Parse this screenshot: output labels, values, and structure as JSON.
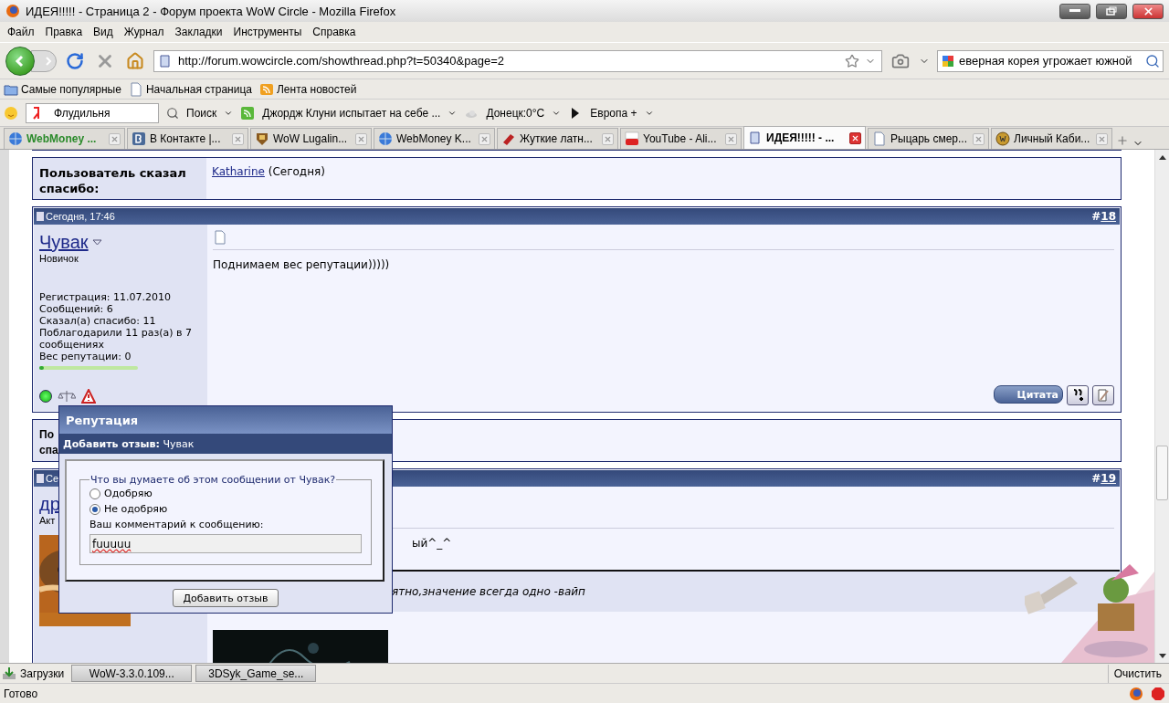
{
  "window": {
    "title": "ИДЕЯ!!!!! - Страница 2 - Форум проекта WoW Circle - Mozilla Firefox"
  },
  "menu": [
    "Файл",
    "Правка",
    "Вид",
    "Журнал",
    "Закладки",
    "Инструменты",
    "Справка"
  ],
  "address": {
    "value": "http://forum.wowcircle.com/showthread.php?t=50340&page=2"
  },
  "search": {
    "value": "еверная корея угрожает южной"
  },
  "bookmarks": [
    {
      "label": "Самые популярные",
      "kind": "folder"
    },
    {
      "label": "Начальная страница",
      "kind": "page"
    },
    {
      "label": "Лента новостей",
      "kind": "feed"
    }
  ],
  "yandex_bar": {
    "field": "Флудильня",
    "search": "Поиск",
    "news": "Джордж Клуни испытает на себе ...",
    "weather": "Донецк:0°С",
    "region": "Европа +"
  },
  "tabs": [
    {
      "label": "WebMoney ...",
      "kind": "globe",
      "highlighted": true,
      "selected": false
    },
    {
      "label": "В Контакте |...",
      "kind": "vk",
      "highlighted": false,
      "selected": false
    },
    {
      "label": "WoW Lugalin...",
      "kind": "shield",
      "highlighted": false,
      "selected": false
    },
    {
      "label": "WebMoney K...",
      "kind": "globe",
      "highlighted": false,
      "selected": false
    },
    {
      "label": "Жуткие латн...",
      "kind": "red",
      "highlighted": false,
      "selected": false
    },
    {
      "label": "YouTube - Ali...",
      "kind": "youtube",
      "highlighted": false,
      "selected": false
    },
    {
      "label": "ИДЕЯ!!!!! - ...",
      "kind": "forum",
      "highlighted": false,
      "selected": true
    },
    {
      "label": "Рыцарь смер...",
      "kind": "page",
      "highlighted": false,
      "selected": false
    },
    {
      "label": "Личный Каби...",
      "kind": "coin",
      "highlighted": false,
      "selected": false
    }
  ],
  "thanks": {
    "label": "Пользователь сказал спасибо:",
    "user": "Katharine",
    "when": "(Сегодня)"
  },
  "post": {
    "date": "Сегодня, 17:46",
    "hash": "#",
    "number": "18",
    "user": "Чувак",
    "rank": "Новичок",
    "online": true,
    "stats": [
      "Регистрация: 11.07.2010",
      "Сообщений: 6",
      "Сказал(а) спасибо: 11",
      "Поблагодарили 11 раз(а) в 7 сообщениях",
      "Вес репутации: 0"
    ],
    "reputation": {
      "level": 0.05
    },
    "message": "Поднимаем вес репутации)))))",
    "quote_button": "Цитата"
  },
  "thanks_partial": [
    "По",
    "спа"
  ],
  "next_post": {
    "date": "Се",
    "hash": "#",
    "number": "19",
    "user": "др",
    "rank": "Акт",
    "message": "ый^_^",
    "signature": "ятно,значение всегда одно -вайп"
  },
  "popup": {
    "title": "Репутация",
    "subtitle": "**Добавить отзыв:** Чувак",
    "legend": "Что вы думаете об этом сообщении от Чувак?",
    "options": [
      {
        "label": "Одобряю",
        "selected": false
      },
      {
        "label": "Не одобряю",
        "selected": true
      }
    ],
    "comment_label": "Ваш комментарий к сообщению:",
    "comment": "fuuuuu",
    "submit": "Добавить отзыв"
  },
  "downloads": {
    "label": "Загрузки",
    "items": [
      "WoW-3.3.0.109...",
      "3DSyk_Game_se..."
    ],
    "clear": "Очистить"
  },
  "status_bar": {
    "text": "Готово"
  }
}
